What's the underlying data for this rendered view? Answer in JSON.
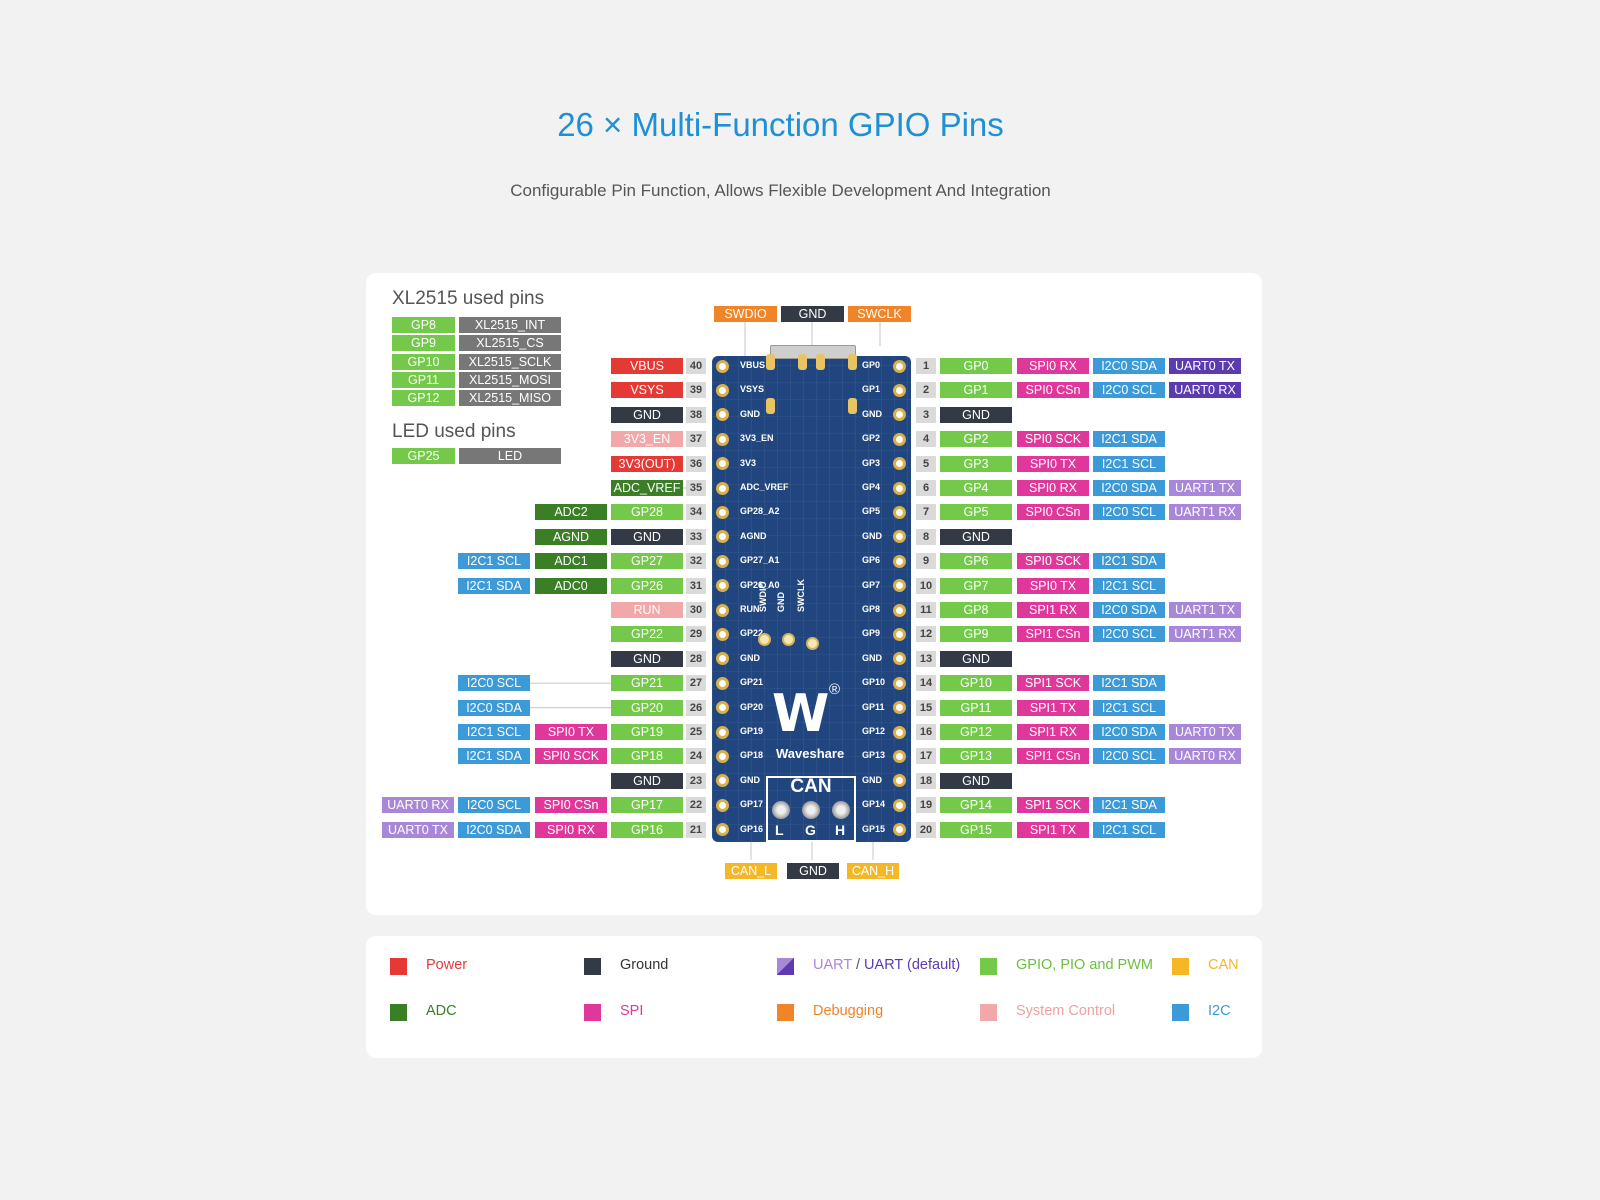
{
  "header": {
    "title": "26 × Multi-Function GPIO Pins",
    "subtitle": "Configurable Pin Function, Allows Flexible Development And Integration"
  },
  "colors": {
    "power": "#e53935",
    "ground": "#333a45",
    "uart": "#a987d8",
    "uart_default": "#5c3ab0",
    "gpio": "#74c94a",
    "can": "#f6b726",
    "adc": "#3a7e25",
    "spi": "#e0389a",
    "debug": "#ef8428",
    "sysctrl": "#f2a8a8",
    "i2c": "#3d9ad8",
    "used": "#777777"
  },
  "xl2515": {
    "heading": "XL2515 used pins",
    "rows": [
      {
        "gp": "GP8",
        "fn": "XL2515_INT"
      },
      {
        "gp": "GP9",
        "fn": "XL2515_CS"
      },
      {
        "gp": "GP10",
        "fn": "XL2515_SCLK"
      },
      {
        "gp": "GP11",
        "fn": "XL2515_MOSI"
      },
      {
        "gp": "GP12",
        "fn": "XL2515_MISO"
      }
    ]
  },
  "led": {
    "heading": "LED used pins",
    "rows": [
      {
        "gp": "GP25",
        "fn": "LED"
      }
    ]
  },
  "top_header": [
    {
      "label": "SWDIO",
      "cat": "debug"
    },
    {
      "label": "GND",
      "cat": "ground"
    },
    {
      "label": "SWCLK",
      "cat": "debug"
    }
  ],
  "bottom_header": [
    {
      "label": "CAN_L",
      "cat": "can"
    },
    {
      "label": "GND",
      "cat": "ground"
    },
    {
      "label": "CAN_H",
      "cat": "can"
    }
  ],
  "left_pins": [
    {
      "num": "40",
      "board": "VBUS",
      "tags": [
        {
          "t": "VBUS",
          "c": "power"
        }
      ]
    },
    {
      "num": "39",
      "board": "VSYS",
      "tags": [
        {
          "t": "VSYS",
          "c": "power"
        }
      ]
    },
    {
      "num": "38",
      "board": "GND",
      "tags": [
        {
          "t": "GND",
          "c": "ground"
        }
      ]
    },
    {
      "num": "37",
      "board": "3V3_EN",
      "tags": [
        {
          "t": "3V3_EN",
          "c": "sysctrl"
        }
      ]
    },
    {
      "num": "36",
      "board": "3V3",
      "tags": [
        {
          "t": "3V3(OUT)",
          "c": "power"
        }
      ]
    },
    {
      "num": "35",
      "board": "ADC_VREF",
      "tags": [
        {
          "t": "ADC_VREF",
          "c": "adc"
        }
      ]
    },
    {
      "num": "34",
      "board": "GP28_A2",
      "tags": [
        {
          "t": "GP28",
          "c": "gpio"
        },
        {
          "t": "ADC2",
          "c": "adc"
        }
      ]
    },
    {
      "num": "33",
      "board": "AGND",
      "tags": [
        {
          "t": "GND",
          "c": "ground"
        },
        {
          "t": "AGND",
          "c": "adc"
        }
      ]
    },
    {
      "num": "32",
      "board": "GP27_A1",
      "tags": [
        {
          "t": "GP27",
          "c": "gpio"
        },
        {
          "t": "ADC1",
          "c": "adc"
        },
        {
          "t": "I2C1 SCL",
          "c": "i2c"
        }
      ]
    },
    {
      "num": "31",
      "board": "GP26_A0",
      "tags": [
        {
          "t": "GP26",
          "c": "gpio"
        },
        {
          "t": "ADC0",
          "c": "adc"
        },
        {
          "t": "I2C1 SDA",
          "c": "i2c"
        }
      ]
    },
    {
      "num": "30",
      "board": "RUN",
      "tags": [
        {
          "t": "RUN",
          "c": "sysctrl"
        }
      ]
    },
    {
      "num": "29",
      "board": "GP22",
      "tags": [
        {
          "t": "GP22",
          "c": "gpio"
        }
      ]
    },
    {
      "num": "28",
      "board": "GND",
      "tags": [
        {
          "t": "GND",
          "c": "ground"
        }
      ]
    },
    {
      "num": "27",
      "board": "GP21",
      "tags": [
        {
          "t": "GP21",
          "c": "gpio"
        },
        {
          "t": "",
          "c": "none"
        },
        {
          "t": "I2C0 SCL",
          "c": "i2c"
        }
      ]
    },
    {
      "num": "26",
      "board": "GP20",
      "tags": [
        {
          "t": "GP20",
          "c": "gpio"
        },
        {
          "t": "",
          "c": "none"
        },
        {
          "t": "I2C0 SDA",
          "c": "i2c"
        }
      ]
    },
    {
      "num": "25",
      "board": "GP19",
      "tags": [
        {
          "t": "GP19",
          "c": "gpio"
        },
        {
          "t": "SPI0 TX",
          "c": "spi"
        },
        {
          "t": "I2C1 SCL",
          "c": "i2c"
        }
      ]
    },
    {
      "num": "24",
      "board": "GP18",
      "tags": [
        {
          "t": "GP18",
          "c": "gpio"
        },
        {
          "t": "SPI0 SCK",
          "c": "spi"
        },
        {
          "t": "I2C1 SDA",
          "c": "i2c"
        }
      ]
    },
    {
      "num": "23",
      "board": "GND",
      "tags": [
        {
          "t": "GND",
          "c": "ground"
        }
      ]
    },
    {
      "num": "22",
      "board": "GP17",
      "tags": [
        {
          "t": "GP17",
          "c": "gpio"
        },
        {
          "t": "SPI0 CSn",
          "c": "spi"
        },
        {
          "t": "I2C0 SCL",
          "c": "i2c"
        },
        {
          "t": "UART0 RX",
          "c": "uart"
        }
      ]
    },
    {
      "num": "21",
      "board": "GP16",
      "tags": [
        {
          "t": "GP16",
          "c": "gpio"
        },
        {
          "t": "SPI0 RX",
          "c": "spi"
        },
        {
          "t": "I2C0 SDA",
          "c": "i2c"
        },
        {
          "t": "UART0 TX",
          "c": "uart"
        }
      ]
    }
  ],
  "right_pins": [
    {
      "num": "1",
      "board": "GP0",
      "tags": [
        {
          "t": "GP0",
          "c": "gpio"
        },
        {
          "t": "SPI0 RX",
          "c": "spi"
        },
        {
          "t": "I2C0 SDA",
          "c": "i2c"
        },
        {
          "t": "UART0 TX",
          "c": "uart_default"
        }
      ]
    },
    {
      "num": "2",
      "board": "GP1",
      "tags": [
        {
          "t": "GP1",
          "c": "gpio"
        },
        {
          "t": "SPI0 CSn",
          "c": "spi"
        },
        {
          "t": "I2C0 SCL",
          "c": "i2c"
        },
        {
          "t": "UART0 RX",
          "c": "uart_default"
        }
      ]
    },
    {
      "num": "3",
      "board": "GND",
      "tags": [
        {
          "t": "GND",
          "c": "ground"
        }
      ]
    },
    {
      "num": "4",
      "board": "GP2",
      "tags": [
        {
          "t": "GP2",
          "c": "gpio"
        },
        {
          "t": "SPI0 SCK",
          "c": "spi"
        },
        {
          "t": "I2C1 SDA",
          "c": "i2c"
        }
      ]
    },
    {
      "num": "5",
      "board": "GP3",
      "tags": [
        {
          "t": "GP3",
          "c": "gpio"
        },
        {
          "t": "SPI0 TX",
          "c": "spi"
        },
        {
          "t": "I2C1 SCL",
          "c": "i2c"
        }
      ]
    },
    {
      "num": "6",
      "board": "GP4",
      "tags": [
        {
          "t": "GP4",
          "c": "gpio"
        },
        {
          "t": "SPI0 RX",
          "c": "spi"
        },
        {
          "t": "I2C0 SDA",
          "c": "i2c"
        },
        {
          "t": "UART1 TX",
          "c": "uart"
        }
      ]
    },
    {
      "num": "7",
      "board": "GP5",
      "tags": [
        {
          "t": "GP5",
          "c": "gpio"
        },
        {
          "t": "SPI0 CSn",
          "c": "spi"
        },
        {
          "t": "I2C0 SCL",
          "c": "i2c"
        },
        {
          "t": "UART1 RX",
          "c": "uart"
        }
      ]
    },
    {
      "num": "8",
      "board": "GND",
      "tags": [
        {
          "t": "GND",
          "c": "ground"
        }
      ]
    },
    {
      "num": "9",
      "board": "GP6",
      "tags": [
        {
          "t": "GP6",
          "c": "gpio"
        },
        {
          "t": "SPI0 SCK",
          "c": "spi"
        },
        {
          "t": "I2C1 SDA",
          "c": "i2c"
        }
      ]
    },
    {
      "num": "10",
      "board": "GP7",
      "tags": [
        {
          "t": "GP7",
          "c": "gpio"
        },
        {
          "t": "SPI0 TX",
          "c": "spi"
        },
        {
          "t": "I2C1 SCL",
          "c": "i2c"
        }
      ]
    },
    {
      "num": "11",
      "board": "GP8",
      "tags": [
        {
          "t": "GP8",
          "c": "gpio"
        },
        {
          "t": "SPI1 RX",
          "c": "spi"
        },
        {
          "t": "I2C0 SDA",
          "c": "i2c"
        },
        {
          "t": "UART1 TX",
          "c": "uart"
        }
      ]
    },
    {
      "num": "12",
      "board": "GP9",
      "tags": [
        {
          "t": "GP9",
          "c": "gpio"
        },
        {
          "t": "SPI1 CSn",
          "c": "spi"
        },
        {
          "t": "I2C0 SCL",
          "c": "i2c"
        },
        {
          "t": "UART1 RX",
          "c": "uart"
        }
      ]
    },
    {
      "num": "13",
      "board": "GND",
      "tags": [
        {
          "t": "GND",
          "c": "ground"
        }
      ]
    },
    {
      "num": "14",
      "board": "GP10",
      "tags": [
        {
          "t": "GP10",
          "c": "gpio"
        },
        {
          "t": "SPI1 SCK",
          "c": "spi"
        },
        {
          "t": "I2C1 SDA",
          "c": "i2c"
        }
      ]
    },
    {
      "num": "15",
      "board": "GP11",
      "tags": [
        {
          "t": "GP11",
          "c": "gpio"
        },
        {
          "t": "SPI1 TX",
          "c": "spi"
        },
        {
          "t": "I2C1 SCL",
          "c": "i2c"
        }
      ]
    },
    {
      "num": "16",
      "board": "GP12",
      "tags": [
        {
          "t": "GP12",
          "c": "gpio"
        },
        {
          "t": "SPI1 RX",
          "c": "spi"
        },
        {
          "t": "I2C0 SDA",
          "c": "i2c"
        },
        {
          "t": "UART0 TX",
          "c": "uart"
        }
      ]
    },
    {
      "num": "17",
      "board": "GP13",
      "tags": [
        {
          "t": "GP13",
          "c": "gpio"
        },
        {
          "t": "SPI1 CSn",
          "c": "spi"
        },
        {
          "t": "I2C0 SCL",
          "c": "i2c"
        },
        {
          "t": "UART0 RX",
          "c": "uart"
        }
      ]
    },
    {
      "num": "18",
      "board": "GND",
      "tags": [
        {
          "t": "GND",
          "c": "ground"
        }
      ]
    },
    {
      "num": "19",
      "board": "GP14",
      "tags": [
        {
          "t": "GP14",
          "c": "gpio"
        },
        {
          "t": "SPI1 SCK",
          "c": "spi"
        },
        {
          "t": "I2C1 SDA",
          "c": "i2c"
        }
      ]
    },
    {
      "num": "20",
      "board": "GP15",
      "tags": [
        {
          "t": "GP15",
          "c": "gpio"
        },
        {
          "t": "SPI1 TX",
          "c": "spi"
        },
        {
          "t": "I2C1 SCL",
          "c": "i2c"
        }
      ]
    }
  ],
  "board": {
    "brand": "Waveshare",
    "logo": "W",
    "registered": "®",
    "can_label": "CAN",
    "can_pins": [
      "L",
      "G",
      "H"
    ],
    "debug_labels": [
      "SWDIO",
      "GND",
      "SWCLK"
    ]
  },
  "legend": [
    {
      "label": "Power",
      "cat": "power"
    },
    {
      "label": "Ground",
      "cat": "ground"
    },
    {
      "label": "UART",
      "label2": "UART (default)",
      "cat": "uart"
    },
    {
      "label": "GPIO, PIO and PWM",
      "cat": "gpio"
    },
    {
      "label": "CAN",
      "cat": "can"
    },
    {
      "label": "ADC",
      "cat": "adc"
    },
    {
      "label": "SPI",
      "cat": "spi"
    },
    {
      "label": "Debugging",
      "cat": "debug"
    },
    {
      "label": "System Control",
      "cat": "sysctrl"
    },
    {
      "label": "I2C",
      "cat": "i2c"
    }
  ]
}
